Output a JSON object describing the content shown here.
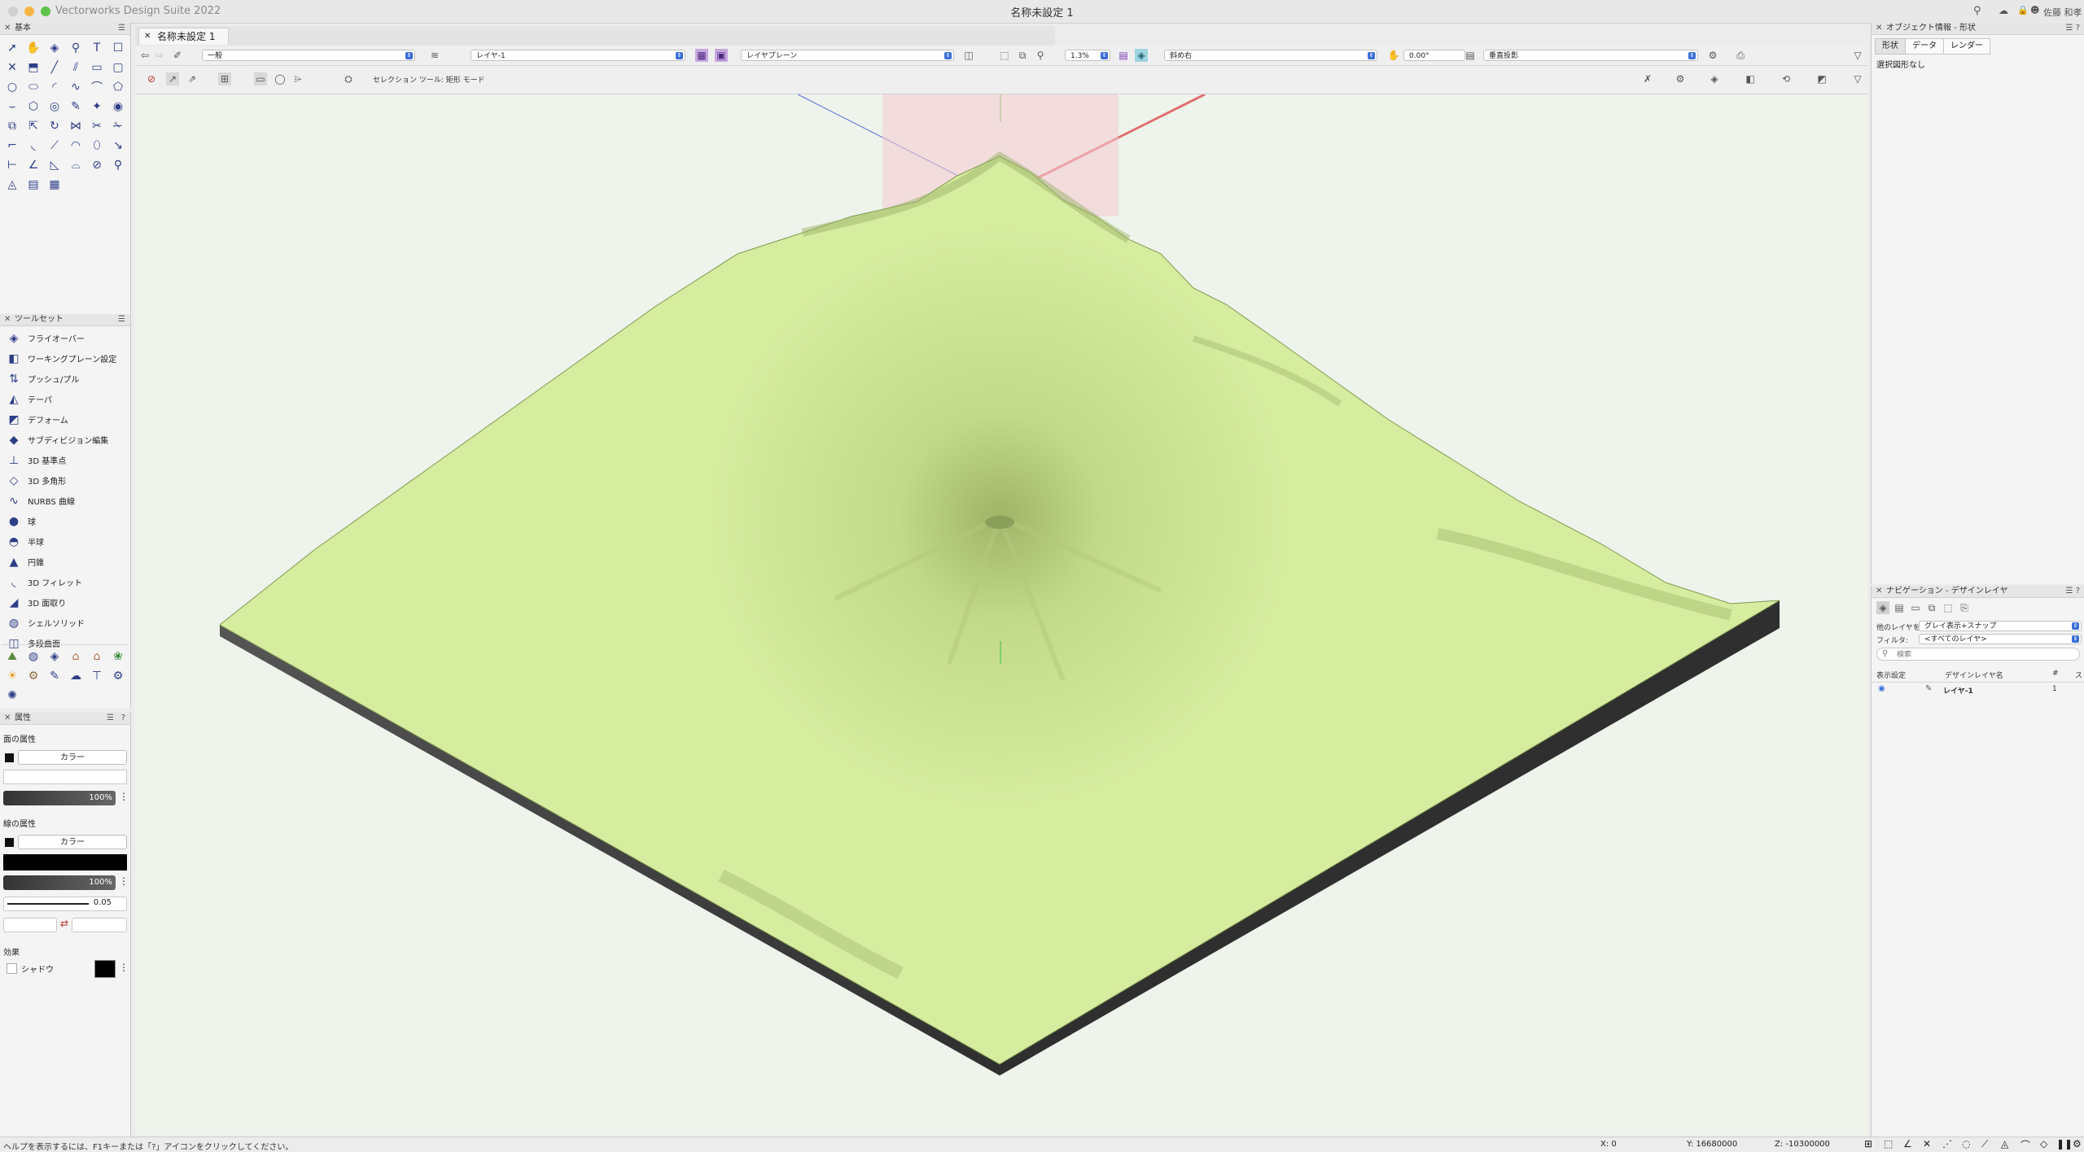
{
  "app": {
    "name": "Vectorworks Design Suite 2022",
    "document_title": "名称未設定 1",
    "user": "佐藤 和孝"
  },
  "doc_tab": {
    "label": "名称未設定 1"
  },
  "panels": {
    "basic": {
      "title": "基本"
    },
    "toolset": {
      "title": "ツールセット",
      "items": [
        {
          "label": "フライオーバー",
          "icon": "flyover-icon"
        },
        {
          "label": "ワーキングプレーン設定",
          "icon": "working-plane-icon"
        },
        {
          "label": "プッシュ/プル",
          "icon": "push-pull-icon"
        },
        {
          "label": "テーパ",
          "icon": "taper-icon"
        },
        {
          "label": "デフォーム",
          "icon": "deform-icon"
        },
        {
          "label": "サブディビジョン編集",
          "icon": "subdivision-icon"
        },
        {
          "label": "3D 基準点",
          "icon": "3d-locus-icon"
        },
        {
          "label": "3D 多角形",
          "icon": "3d-polygon-icon"
        },
        {
          "label": "NURBS 曲線",
          "icon": "nurbs-icon"
        },
        {
          "label": "球",
          "icon": "sphere-icon"
        },
        {
          "label": "半球",
          "icon": "hemisphere-icon"
        },
        {
          "label": "円錐",
          "icon": "cone-icon"
        },
        {
          "label": "3D フィレット",
          "icon": "3d-fillet-icon"
        },
        {
          "label": "3D 面取り",
          "icon": "3d-chamfer-icon"
        },
        {
          "label": "シェルソリッド",
          "icon": "shell-solid-icon"
        },
        {
          "label": "多段曲面",
          "icon": "loft-icon"
        }
      ]
    },
    "attributes": {
      "title": "属性",
      "help": "?",
      "fill_label": "面の属性",
      "fill_type": "カラー",
      "fill_opacity": "100%",
      "pen_label": "線の属性",
      "pen_type": "カラー",
      "pen_opacity": "100%",
      "line_weight": "0.05",
      "effects_label": "効果",
      "shadow_label": "シャドウ"
    }
  },
  "view_bar": {
    "class": "一般",
    "layer": "レイヤ-1",
    "plane": "レイヤプレーン",
    "zoom": "1.3%",
    "view": "斜め右",
    "rotation": "0.00°",
    "projection": "垂直投影"
  },
  "tool_bar": {
    "mode_text": "セレクション ツール: 矩形 モード"
  },
  "object_info": {
    "title": "オブジェクト情報 - 形状",
    "tabs": [
      "形状",
      "データ",
      "レンダー"
    ],
    "active_tab": 0,
    "no_selection": "選択図形なし"
  },
  "navigation": {
    "title": "ナビゲーション - デザインレイヤ",
    "other_layers_label": "他のレイヤを:",
    "other_layers_value": "グレイ表示+スナップ",
    "filter_label": "フィルタ:",
    "filter_value": "<すべてのレイヤ>",
    "search_placeholder": "検索",
    "col_visibility": "表示設定",
    "col_name": "デザインレイヤ名",
    "col_num": "#",
    "col_s": "ス",
    "rows": [
      {
        "name": "レイヤ-1",
        "num": "1"
      }
    ]
  },
  "status": {
    "help": "ヘルプを表示するには、F1キーまたは「?」アイコンをクリックしてください。",
    "x": "X: 0",
    "y": "Y: 16680000",
    "z": "Z: -10300000"
  },
  "colors": {
    "terrain": "#d2e99a",
    "terrain_shadow": "#b5cc7c",
    "base": "#3a3a3a",
    "canvas": "#eef4ec",
    "accent": "#3b6fd8"
  }
}
